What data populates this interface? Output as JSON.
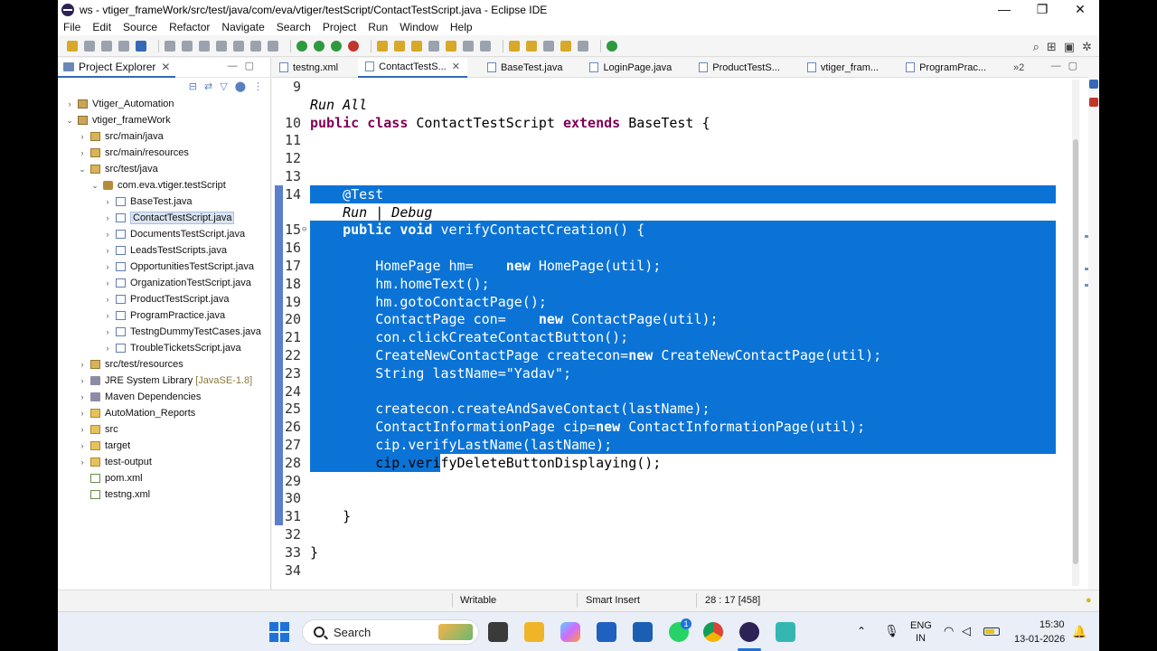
{
  "window": {
    "title": "ws - vtiger_frameWork/src/test/java/com/eva/vtiger/testScript/ContactTestScript.java - Eclipse IDE",
    "controls": [
      "—",
      "❐",
      "✕"
    ]
  },
  "menu": [
    "File",
    "Edit",
    "Source",
    "Refactor",
    "Navigate",
    "Search",
    "Project",
    "Run",
    "Window",
    "Help"
  ],
  "explorer": {
    "title": "Project Explorer",
    "tree": [
      {
        "label": "Vtiger_Automation",
        "depth": 0,
        "arrow": "›",
        "icon": "project"
      },
      {
        "label": "vtiger_frameWork",
        "depth": 0,
        "arrow": "⌄",
        "icon": "project"
      },
      {
        "label": "src/main/java",
        "depth": 1,
        "arrow": "›",
        "icon": "src"
      },
      {
        "label": "src/main/resources",
        "depth": 1,
        "arrow": "›",
        "icon": "src"
      },
      {
        "label": "src/test/java",
        "depth": 1,
        "arrow": "⌄",
        "icon": "src"
      },
      {
        "label": "com.eva.vtiger.testScript",
        "depth": 2,
        "arrow": "⌄",
        "icon": "pkg"
      },
      {
        "label": "BaseTest.java",
        "depth": 3,
        "arrow": "›",
        "icon": "java"
      },
      {
        "label": "ContactTestScript.java",
        "depth": 3,
        "arrow": "›",
        "icon": "java",
        "selected": true
      },
      {
        "label": "DocumentsTestScript.java",
        "depth": 3,
        "arrow": "›",
        "icon": "java"
      },
      {
        "label": "LeadsTestScripts.java",
        "depth": 3,
        "arrow": "›",
        "icon": "java"
      },
      {
        "label": "OpportunitiesTestScript.java",
        "depth": 3,
        "arrow": "›",
        "icon": "java"
      },
      {
        "label": "OrganizationTestScript.java",
        "depth": 3,
        "arrow": "›",
        "icon": "java"
      },
      {
        "label": "ProductTestScript.java",
        "depth": 3,
        "arrow": "›",
        "icon": "java"
      },
      {
        "label": "ProgramPractice.java",
        "depth": 3,
        "arrow": "›",
        "icon": "java"
      },
      {
        "label": "TestngDummyTestCases.java",
        "depth": 3,
        "arrow": "›",
        "icon": "java"
      },
      {
        "label": "TroubleTicketsScript.java",
        "depth": 3,
        "arrow": "›",
        "icon": "java"
      },
      {
        "label": "src/test/resources",
        "depth": 1,
        "arrow": "›",
        "icon": "src"
      },
      {
        "label": "JRE System Library",
        "suffix": "[JavaSE-1.8]",
        "depth": 1,
        "arrow": "›",
        "icon": "lib"
      },
      {
        "label": "Maven Dependencies",
        "depth": 1,
        "arrow": "›",
        "icon": "lib"
      },
      {
        "label": "AutoMation_Reports",
        "depth": 1,
        "arrow": "›",
        "icon": "folder"
      },
      {
        "label": "src",
        "depth": 1,
        "arrow": "›",
        "icon": "folder"
      },
      {
        "label": "target",
        "depth": 1,
        "arrow": "›",
        "icon": "folder"
      },
      {
        "label": "test-output",
        "depth": 1,
        "arrow": "›",
        "icon": "folder"
      },
      {
        "label": "pom.xml",
        "depth": 1,
        "arrow": "",
        "icon": "xml"
      },
      {
        "label": "testng.xml",
        "depth": 1,
        "arrow": "",
        "icon": "xml"
      }
    ]
  },
  "editor_tabs": [
    {
      "label": "testng.xml",
      "active": false
    },
    {
      "label": "ContactTestS...",
      "active": true
    },
    {
      "label": "BaseTest.java",
      "active": false
    },
    {
      "label": "LoginPage.java",
      "active": false
    },
    {
      "label": "ProductTestS...",
      "active": false
    },
    {
      "label": "vtiger_fram...",
      "active": false
    },
    {
      "label": "ProgramPrac...",
      "active": false
    }
  ],
  "editor_tabs_overflow": "»2",
  "code": {
    "lines": [
      {
        "n": "9",
        "text": ""
      },
      {
        "n": "",
        "text": "Run All",
        "lens": true
      },
      {
        "n": "10",
        "text": "public class ContactTestScript extends BaseTest {"
      },
      {
        "n": "11",
        "text": ""
      },
      {
        "n": "12",
        "text": ""
      },
      {
        "n": "13",
        "text": ""
      },
      {
        "n": "14",
        "text": "    @Test",
        "sel": true
      },
      {
        "n": "",
        "text": "    Run | Debug",
        "lens": true
      },
      {
        "n": "15",
        "text": "    public void verifyContactCreation() {",
        "sel": true,
        "fold": true
      },
      {
        "n": "16",
        "text": "",
        "sel": true
      },
      {
        "n": "17",
        "text": "        HomePage hm=    new HomePage(util);",
        "sel": true
      },
      {
        "n": "18",
        "text": "        hm.homeText();",
        "sel": true
      },
      {
        "n": "19",
        "text": "        hm.gotoContactPage();",
        "sel": true
      },
      {
        "n": "20",
        "text": "        ContactPage con=    new ContactPage(util);",
        "sel": true
      },
      {
        "n": "21",
        "text": "        con.clickCreateContactButton();",
        "sel": true
      },
      {
        "n": "22",
        "text": "        CreateNewContactPage createcon=new CreateNewContactPage(util);",
        "sel": true
      },
      {
        "n": "23",
        "text": "        String lastName=\"Yadav\";",
        "sel": true
      },
      {
        "n": "24",
        "text": "",
        "sel": true
      },
      {
        "n": "25",
        "text": "        createcon.createAndSaveContact(lastName);",
        "sel": true
      },
      {
        "n": "26",
        "text": "        ContactInformationPage cip=new ContactInformationPage(util);",
        "sel": true
      },
      {
        "n": "27",
        "text": "        cip.verifyLastName(lastName);",
        "sel": true
      },
      {
        "n": "28",
        "text": "        cip.verifyDeleteButtonDisplaying();",
        "partial": true
      },
      {
        "n": "29",
        "text": ""
      },
      {
        "n": "30",
        "text": ""
      },
      {
        "n": "31",
        "text": "    }"
      },
      {
        "n": "32",
        "text": ""
      },
      {
        "n": "33",
        "text": "}"
      },
      {
        "n": "34",
        "text": ""
      }
    ]
  },
  "status": {
    "mode": "Writable",
    "insert": "Smart Insert",
    "position": "28 : 17 [458]"
  },
  "taskbar": {
    "search_placeholder": "Search",
    "lang": "ENG",
    "region": "IN",
    "time": "15:30",
    "date": "13-01-2026",
    "whatsapp_badge": "1"
  }
}
